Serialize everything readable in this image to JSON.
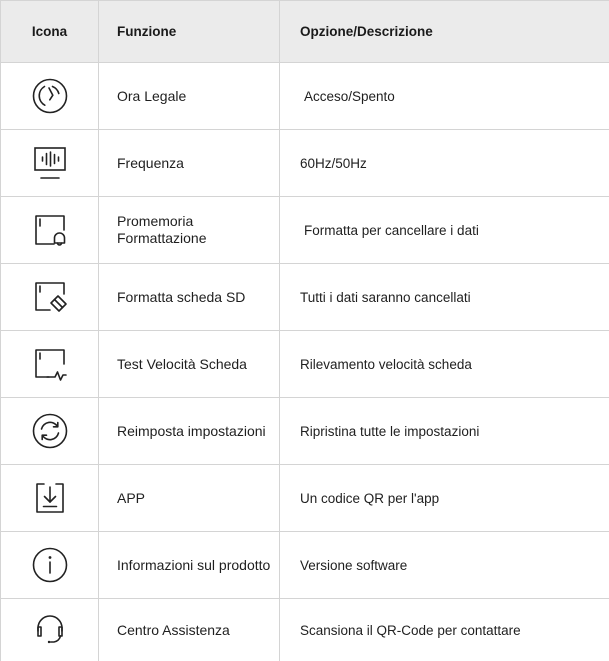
{
  "table": {
    "headers": {
      "icon": "Icona",
      "function": "Funzione",
      "description": "Opzione/Descrizione"
    },
    "rows": [
      {
        "icon": "clock-icon",
        "function": "Ora Legale",
        "description": "Acceso/Spento"
      },
      {
        "icon": "frequency-monitor-icon",
        "function": "Frequenza",
        "description": "60Hz/50Hz"
      },
      {
        "icon": "format-reminder-icon",
        "function": "Promemoria Formattazione",
        "description": "Formatta per cancellare i dati"
      },
      {
        "icon": "format-sd-card-icon",
        "function": "Formatta scheda SD",
        "description": "Tutti i dati saranno cancellati"
      },
      {
        "icon": "card-speed-test-icon",
        "function": "Test Velocità Scheda",
        "description": "Rilevamento velocità scheda"
      },
      {
        "icon": "reset-icon",
        "function": "Reimposta impostazioni",
        "description": "Ripristina tutte le impostazioni"
      },
      {
        "icon": "download-app-icon",
        "function": "APP",
        "description": "Un codice QR per l'app"
      },
      {
        "icon": "info-icon",
        "function": "Informazioni sul prodotto",
        "description": "Versione software"
      },
      {
        "icon": "headset-icon",
        "function": "Centro Assistenza",
        "description": "Scansiona il QR-Code per contattare"
      }
    ]
  }
}
